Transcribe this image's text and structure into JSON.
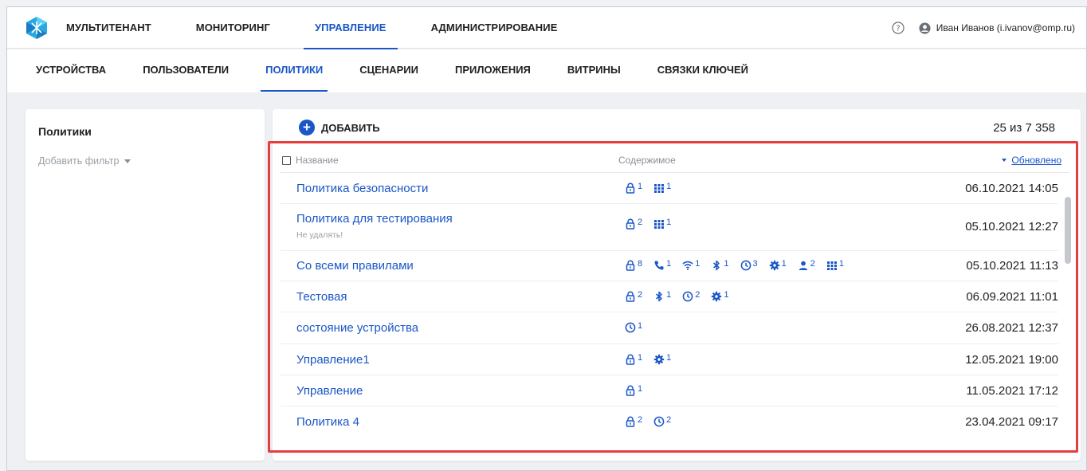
{
  "topnav": {
    "items": [
      "МУЛЬТИТЕНАНТ",
      "МОНИТОРИНГ",
      "УПРАВЛЕНИЕ",
      "АДМИНИСТРИРОВАНИЕ"
    ],
    "active": "УПРАВЛЕНИЕ",
    "user": "Иван Иванов (i.ivanov@omp.ru)"
  },
  "subnav": {
    "items": [
      "УСТРОЙСТВА",
      "ПОЛЬЗОВАТЕЛИ",
      "ПОЛИТИКИ",
      "СЦЕНАРИИ",
      "ПРИЛОЖЕНИЯ",
      "ВИТРИНЫ",
      "СВЯЗКИ КЛЮЧЕЙ"
    ],
    "active": "ПОЛИТИКИ"
  },
  "left": {
    "title": "Политики",
    "filter": "Добавить фильтр"
  },
  "main": {
    "add_label": "ДОБАВИТЬ",
    "count": "25 из 7 358",
    "columns": {
      "name": "Название",
      "content": "Содержимое",
      "updated": "Обновлено"
    },
    "rows": [
      {
        "name": "Политика безопасности",
        "sub": "",
        "date": "06.10.2021 14:05",
        "content": [
          {
            "icon": "lock",
            "n": "1"
          },
          {
            "icon": "apps",
            "n": "1"
          }
        ]
      },
      {
        "name": "Политика для тестирования",
        "sub": "Не удалять!",
        "date": "05.10.2021 12:27",
        "content": [
          {
            "icon": "lock",
            "n": "2"
          },
          {
            "icon": "apps",
            "n": "1"
          }
        ]
      },
      {
        "name": "Со всеми правилами",
        "sub": "",
        "date": "05.10.2021 11:13",
        "content": [
          {
            "icon": "lock",
            "n": "8"
          },
          {
            "icon": "phone",
            "n": "1"
          },
          {
            "icon": "wifi",
            "n": "1"
          },
          {
            "icon": "bluetooth",
            "n": "1"
          },
          {
            "icon": "clock",
            "n": "3"
          },
          {
            "icon": "gear",
            "n": "1"
          },
          {
            "icon": "person",
            "n": "2"
          },
          {
            "icon": "apps",
            "n": "1"
          }
        ]
      },
      {
        "name": "Тестовая",
        "sub": "",
        "date": "06.09.2021 11:01",
        "content": [
          {
            "icon": "lock",
            "n": "2"
          },
          {
            "icon": "bluetooth",
            "n": "1"
          },
          {
            "icon": "clock",
            "n": "2"
          },
          {
            "icon": "gear",
            "n": "1"
          }
        ]
      },
      {
        "name": "состояние устройства",
        "sub": "",
        "date": "26.08.2021 12:37",
        "content": [
          {
            "icon": "clock",
            "n": "1"
          }
        ]
      },
      {
        "name": "Управление1",
        "sub": "",
        "date": "12.05.2021 19:00",
        "content": [
          {
            "icon": "lock",
            "n": "1"
          },
          {
            "icon": "gear",
            "n": "1"
          }
        ]
      },
      {
        "name": "Управление",
        "sub": "",
        "date": "11.05.2021 17:12",
        "content": [
          {
            "icon": "lock",
            "n": "1"
          }
        ]
      },
      {
        "name": "Политика 4",
        "sub": "",
        "date": "23.04.2021 09:17",
        "content": [
          {
            "icon": "lock",
            "n": "2"
          },
          {
            "icon": "clock",
            "n": "2"
          }
        ]
      }
    ]
  },
  "colors": {
    "accent": "#1a56c7",
    "highlight": "#e53e3e"
  }
}
